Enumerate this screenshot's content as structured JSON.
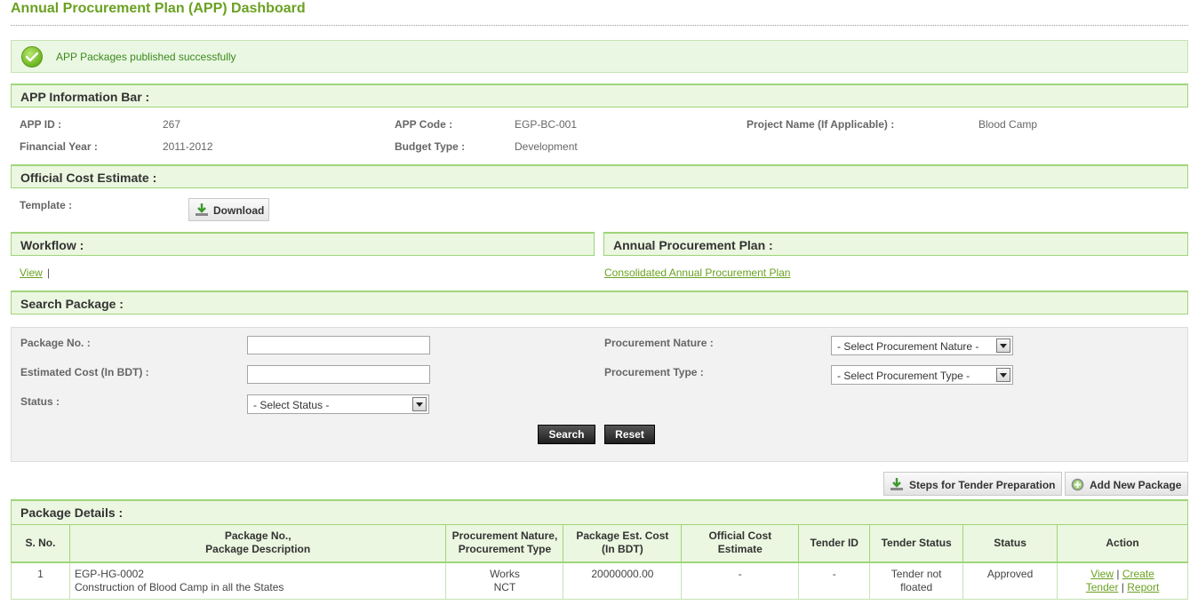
{
  "page": {
    "title": "Annual Procurement Plan (APP) Dashboard"
  },
  "alert": {
    "message": "APP Packages published successfully"
  },
  "app_info": {
    "section_title": "APP Information Bar :",
    "app_id_label": "APP ID :",
    "app_id_value": "267",
    "app_code_label": "APP Code :",
    "app_code_value": "EGP-BC-001",
    "project_name_label": "Project Name (If Applicable) :",
    "project_name_value": "Blood Camp",
    "financial_year_label": "Financial Year :",
    "financial_year_value": "2011-2012",
    "budget_type_label": "Budget Type :",
    "budget_type_value": "Development"
  },
  "cost_estimate": {
    "section_title": "Official Cost Estimate :",
    "template_label": "Template :",
    "download_label": "Download"
  },
  "workflow": {
    "section_title": "Workflow :",
    "view_link": "View",
    "separator": "|"
  },
  "app_plan": {
    "section_title": "Annual Procurement Plan :",
    "consolidated_link": "Consolidated Annual Procurement Plan"
  },
  "search": {
    "section_title": "Search Package :",
    "package_no_label": "Package No. :",
    "package_no_value": "",
    "estimated_cost_label": "Estimated Cost (In BDT) :",
    "estimated_cost_value": "",
    "status_label": "Status :",
    "status_selected": "- Select Status -",
    "procurement_nature_label": "Procurement Nature :",
    "procurement_nature_selected": "- Select Procurement Nature -",
    "procurement_type_label": "Procurement Type :",
    "procurement_type_selected": "- Select Procurement Type -",
    "search_button": "Search",
    "reset_button": "Reset"
  },
  "toolbar": {
    "steps_button": "Steps for Tender Preparation",
    "add_package_button": "Add New Package"
  },
  "package_details": {
    "section_title": "Package Details :",
    "headers": {
      "sno": "S. No.",
      "package_line1": "Package No.,",
      "package_line2": "Package Description",
      "nature_line1": "Procurement Nature,",
      "nature_line2": "Procurement Type",
      "cost_line1": "Package Est. Cost",
      "cost_line2": "(In BDT)",
      "official_line1": "Official Cost",
      "official_line2": "Estimate",
      "tender_id": "Tender ID",
      "tender_status": "Tender Status",
      "status": "Status",
      "action": "Action"
    },
    "rows": [
      {
        "sno": "1",
        "package_no": "EGP-HG-0002",
        "description": "Construction of Blood Camp in all the States",
        "nature": "Works",
        "type": "NCT",
        "est_cost": "20000000.00",
        "official_estimate": "-",
        "tender_id": "-",
        "tender_status_line1": "Tender not",
        "tender_status_line2": "floated",
        "status": "Approved",
        "action_view": "View",
        "action_create_line1": "Create",
        "action_create_line2": "Tender",
        "action_report": "Report",
        "action_sep": "|"
      }
    ]
  }
}
